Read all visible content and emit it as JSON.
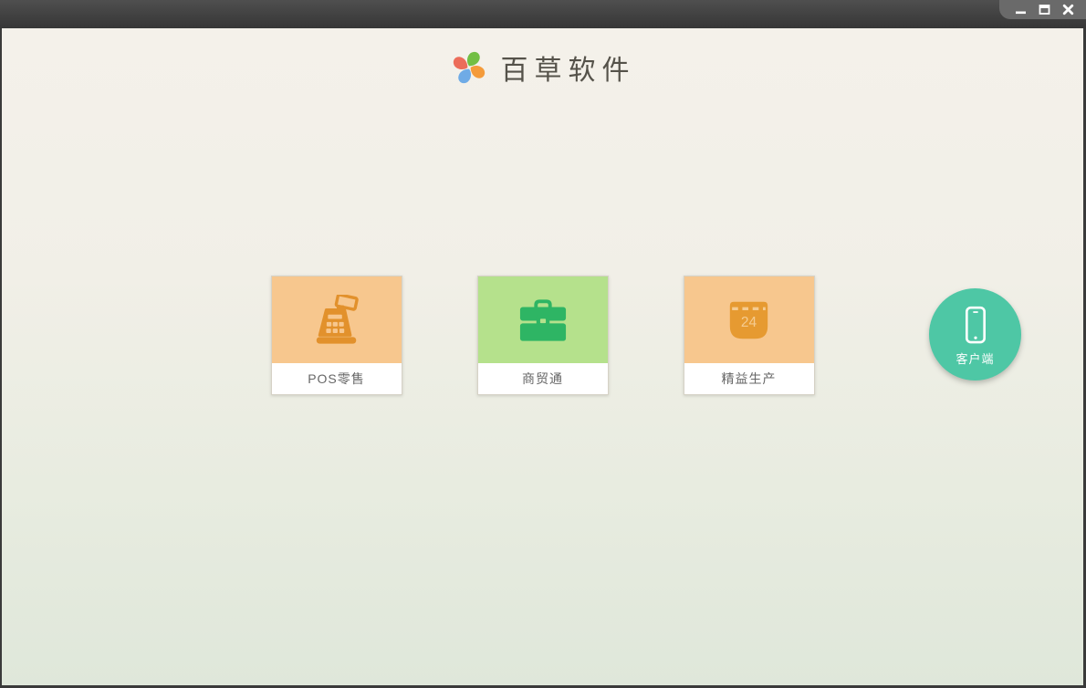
{
  "window": {
    "title_bar": {
      "controls": [
        {
          "id": "minimize",
          "icon": "minimize-icon"
        },
        {
          "id": "maximize",
          "icon": "maximize-icon"
        },
        {
          "id": "close",
          "icon": "close-icon"
        }
      ]
    }
  },
  "header": {
    "title": "百草软件",
    "logo": {
      "name": "pinwheel-logo",
      "petal_colors": [
        "#72bf44",
        "#f49b3b",
        "#6fabe6",
        "#ec6d5a"
      ]
    }
  },
  "products": [
    {
      "label": "POS零售",
      "icon": "cash-register-icon",
      "tile_color": "#f7c78e",
      "icon_color": "#e2912c",
      "icon_secondary": "#f7c78e"
    },
    {
      "label": "商贸通",
      "icon": "briefcase-icon",
      "tile_color": "#b5e18c",
      "icon_color": "#2eb564",
      "icon_secondary": "#b5e18c"
    },
    {
      "label": "精益生产",
      "icon": "calendar-icon",
      "tile_color": "#f7c78e",
      "icon_color": "#e69a31",
      "icon_secondary": "#f5cb90",
      "calendar_day": "24"
    }
  ],
  "client_button": {
    "label": "客户端",
    "icon": "smartphone-icon",
    "color": "#4ec7a5",
    "icon_color": "#ffffff"
  },
  "theme": {
    "bg_top": "#f4f1ea",
    "bg_bottom": "#dfe7da",
    "titlebar": "#434343",
    "frame": "#3a3a3a",
    "card_bg": "#ffffff",
    "title_color": "#55524a",
    "label_color": "#666666"
  }
}
